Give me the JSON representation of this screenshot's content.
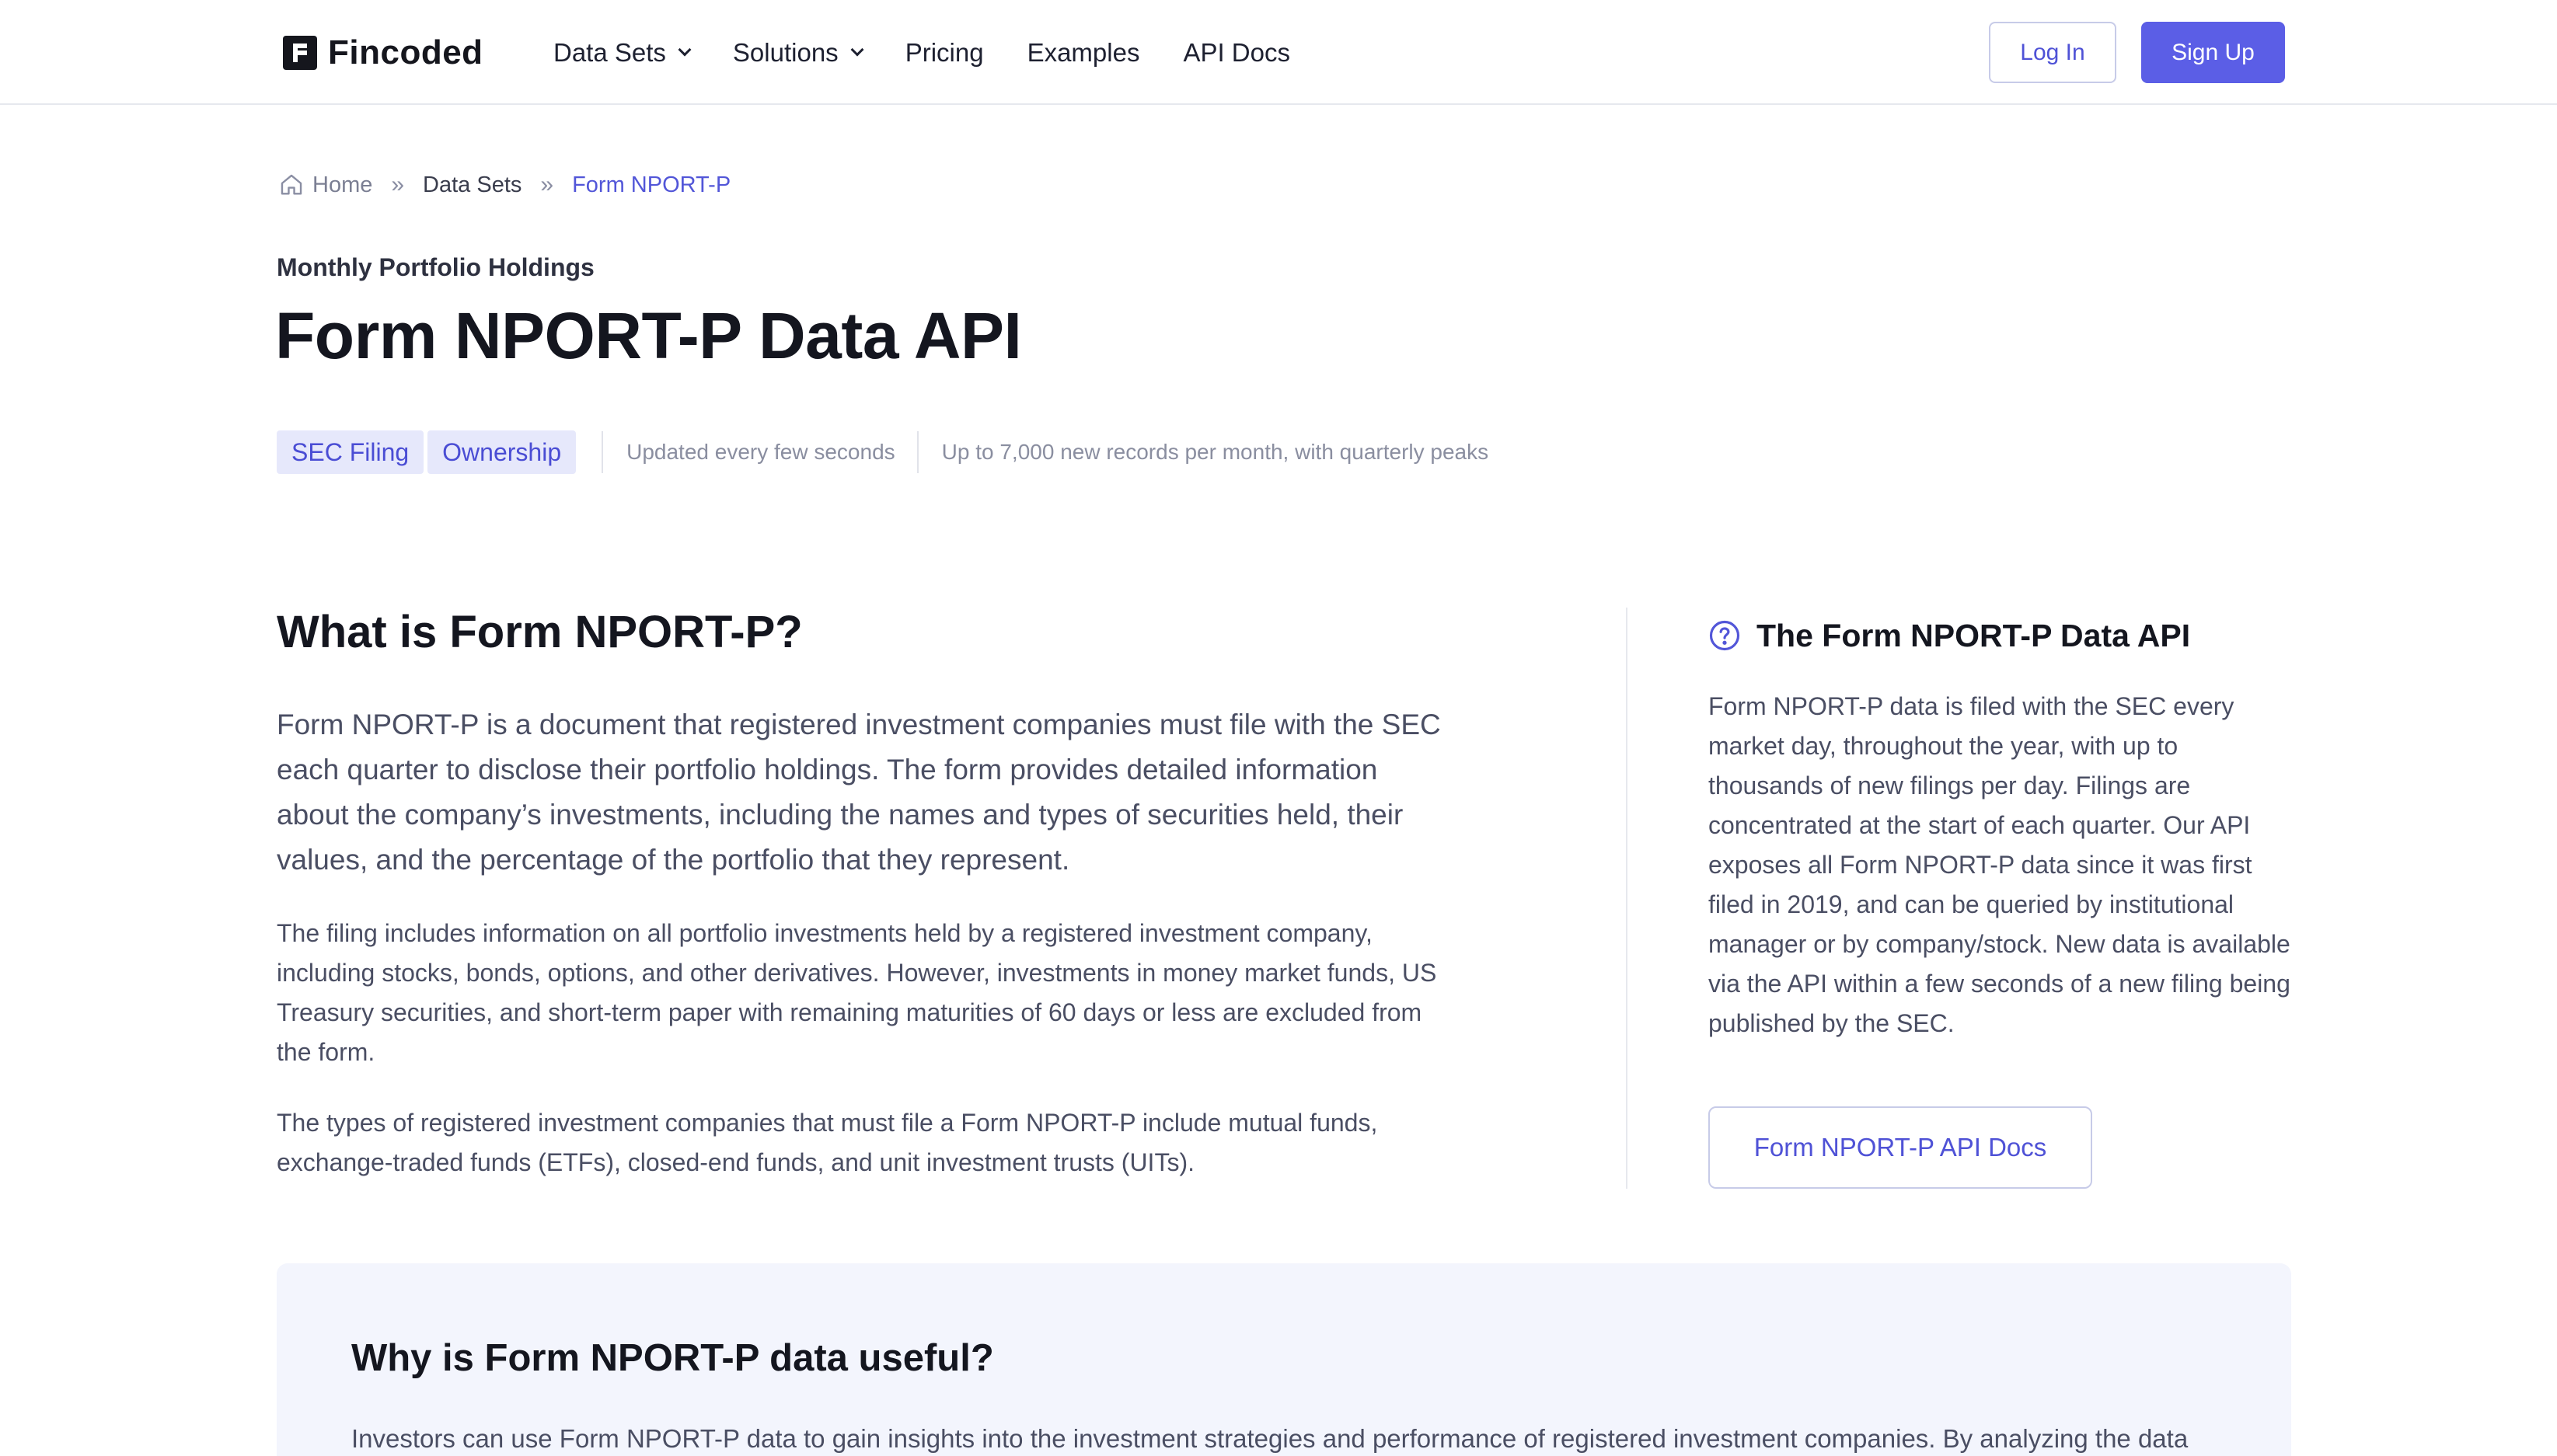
{
  "header": {
    "brand": "Fincoded",
    "nav": [
      {
        "label": "Data Sets",
        "dropdown": true
      },
      {
        "label": "Solutions",
        "dropdown": true
      },
      {
        "label": "Pricing",
        "dropdown": false
      },
      {
        "label": "Examples",
        "dropdown": false
      },
      {
        "label": "API Docs",
        "dropdown": false
      }
    ],
    "login_label": "Log In",
    "signup_label": "Sign Up"
  },
  "breadcrumb": {
    "home": "Home",
    "separator": "»",
    "items": [
      "Data Sets",
      "Form NPORT-P"
    ]
  },
  "hero": {
    "eyebrow": "Monthly Portfolio Holdings",
    "title": "Form NPORT-P Data API",
    "tags": [
      "SEC Filing",
      "Ownership"
    ],
    "update_note": "Updated every few seconds",
    "volume_note": "Up to 7,000 new records per month, with quarterly peaks"
  },
  "main": {
    "heading": "What is Form NPORT-P?",
    "lead": "Form NPORT-P is a document that registered investment companies must file with the SEC each quarter to disclose their portfolio holdings. The form provides detailed information about the company’s investments, including the names and types of securities held, their values, and the percentage of the portfolio that they represent.",
    "paragraph1": "The filing includes information on all portfolio investments held by a registered investment company, including stocks, bonds, options, and other derivatives. However, investments in money market funds, US Treasury securities, and short-term paper with remaining maturities of 60 days or less are excluded from the form.",
    "paragraph2": "The types of registered investment companies that must file a Form NPORT-P include mutual funds, exchange-traded funds (ETFs), closed-end funds, and unit investment trusts (UITs)."
  },
  "sidebar": {
    "title": "The Form NPORT-P Data API",
    "body": "Form NPORT-P data is filed with the SEC every market day, throughout the year, with up to thousands of new filings per day. Filings are concentrated at the start of each quarter. Our API exposes all Form NPORT-P data since it was first filed in 2019, and can be queried by institutional manager or by company/stock. New data is available via the API within a few seconds of a new filing being published by the SEC.",
    "button_label": "Form NPORT-P API Docs"
  },
  "useful": {
    "heading": "Why is Form NPORT-P data useful?",
    "text": "Investors can use Form NPORT-P data to gain insights into the investment strategies and performance of registered investment companies. By analyzing the data"
  },
  "colors": {
    "accent": "#5b5ee6",
    "accent_text": "#4f52d6",
    "tag_bg": "#e6e8fb",
    "panel_bg": "#f3f5fd"
  },
  "icons": [
    "home-icon",
    "chevron-down-icon",
    "question-circle-icon"
  ]
}
